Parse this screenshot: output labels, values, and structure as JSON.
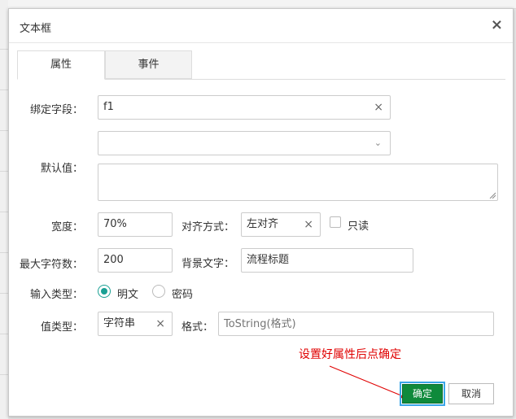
{
  "dialog": {
    "title": "文本框",
    "close_glyph": "×"
  },
  "tabs": [
    {
      "label": "属性",
      "active": true
    },
    {
      "label": "事件",
      "active": false
    }
  ],
  "form": {
    "bind_field": {
      "label": "绑定字段：",
      "value": "f1"
    },
    "default_value": {
      "label": "默认值：",
      "select_value": "",
      "text_value": ""
    },
    "width": {
      "label": "宽度：",
      "value": "70%"
    },
    "align": {
      "label": "对齐方式：",
      "value": "左对齐"
    },
    "readonly": {
      "label": "只读",
      "checked": false
    },
    "max_length": {
      "label": "最大字符数：",
      "value": "200"
    },
    "placeholder_text": {
      "label": "背景文字：",
      "value": "流程标题"
    },
    "input_type": {
      "label": "输入类型：",
      "options": [
        {
          "label": "明文",
          "selected": true
        },
        {
          "label": "密码",
          "selected": false
        }
      ]
    },
    "value_type": {
      "label": "值类型：",
      "value": "字符串"
    },
    "format": {
      "label": "格式：",
      "placeholder": "ToString(格式)"
    }
  },
  "annotation": {
    "text": "设置好属性后点确定",
    "color": "#e00000"
  },
  "buttons": {
    "ok": "确定",
    "cancel": "取消"
  },
  "colors": {
    "accent_green": "#0f8a3b",
    "radio_teal": "#1aa094"
  },
  "icons": {
    "clear": "×",
    "dropdown": "⌄"
  }
}
